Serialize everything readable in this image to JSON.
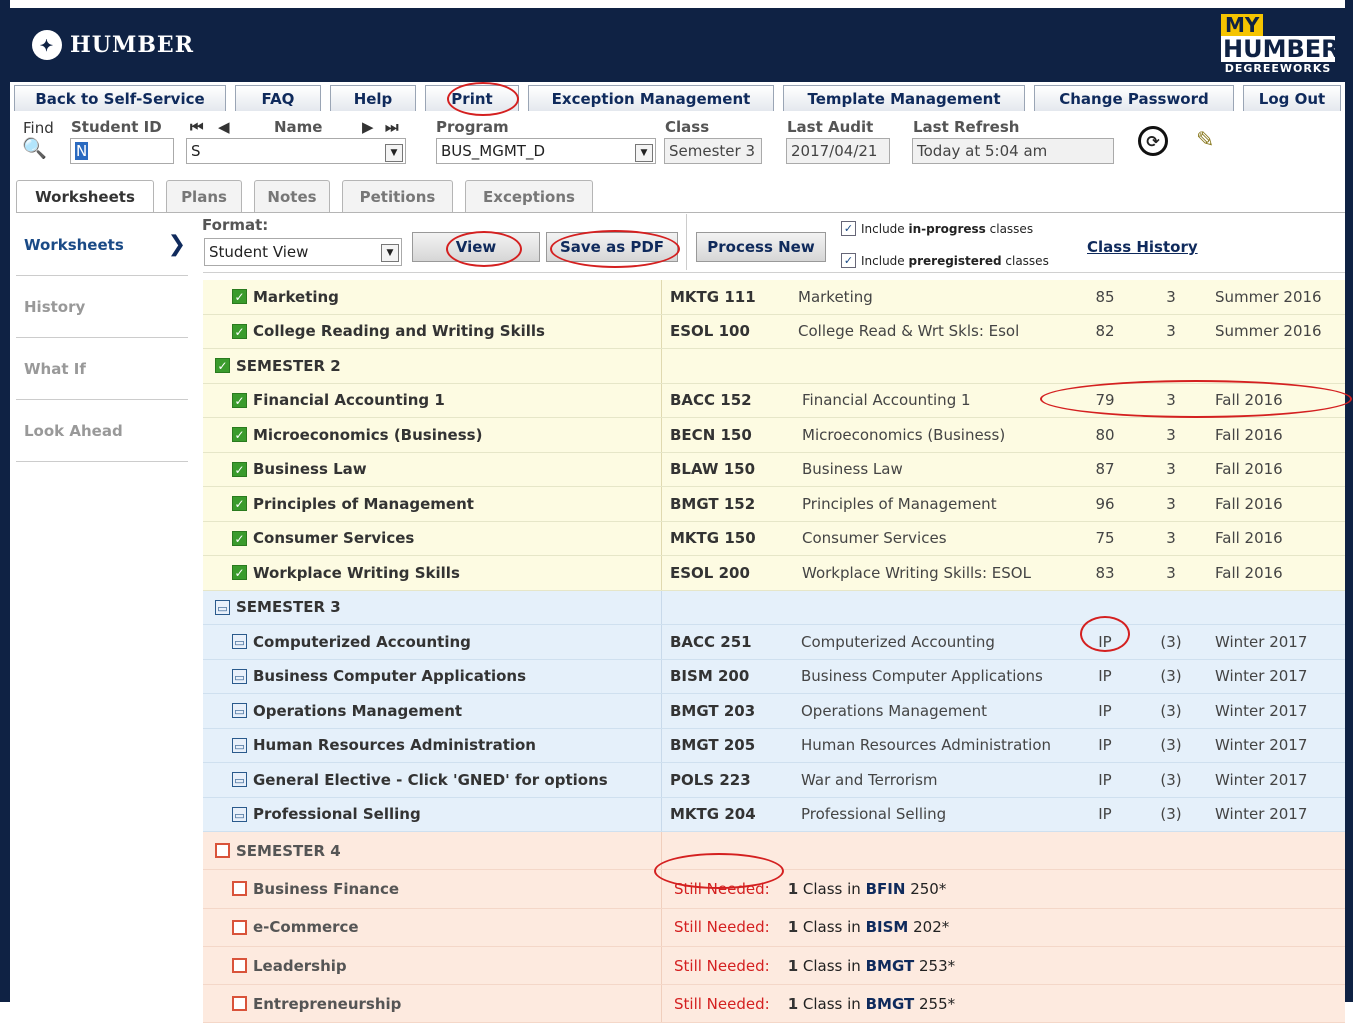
{
  "brand": {
    "logo_text": "HUMBER",
    "badge_my": "MY",
    "badge_humber": "HUMBER",
    "badge_dw": "DEGREEWORKS"
  },
  "nav": [
    "Back to Self-Service",
    "FAQ",
    "Help",
    "Print",
    "Exception Management",
    "Template Management",
    "Change Password",
    "Log Out"
  ],
  "search": {
    "find_label": "Find",
    "student_id_label": "Student ID",
    "name_label": "Name",
    "program_label": "Program",
    "class_label": "Class",
    "last_audit_label": "Last Audit",
    "last_refresh_label": "Last Refresh",
    "nav_first": "⏮",
    "nav_prev": "◀",
    "nav_next": "▶",
    "nav_last": "⏭",
    "student_id_value": "N",
    "name_value": "S",
    "program_value": "BUS_MGMT_D",
    "class_value": "Semester 3",
    "last_audit_value": "2017/04/21",
    "last_refresh_value": "Today at 5:04 am"
  },
  "tabs": [
    "Worksheets",
    "Plans",
    "Notes",
    "Petitions",
    "Exceptions"
  ],
  "sidebar": [
    "Worksheets",
    "History",
    "What If",
    "Look Ahead"
  ],
  "toolbar": {
    "format_label": "Format:",
    "format_value": "Student View",
    "view": "View",
    "save_pdf": "Save as PDF",
    "process_new": "Process New",
    "chk1_a": "Include ",
    "chk1_b": "in-progress",
    "chk1_c": " classes",
    "chk2_a": "Include ",
    "chk2_b": "preregistered",
    "chk2_c": " classes",
    "class_history": "Class History"
  },
  "rows": [
    {
      "kind": "course",
      "color": "yellow",
      "status": "ok",
      "name": "Marketing",
      "code": "MKTG 111",
      "title": "Marketing",
      "grade": "85",
      "credits": "3",
      "term": "Summer 2016"
    },
    {
      "kind": "course",
      "color": "yellow",
      "status": "ok",
      "name": "College Reading and Writing Skills",
      "code": "ESOL 100",
      "title": "College Read & Wrt Skls: Esol",
      "grade": "82",
      "credits": "3",
      "term": "Summer 2016"
    },
    {
      "kind": "header",
      "color": "yellow",
      "status": "ok",
      "name": "SEMESTER 2"
    },
    {
      "kind": "course",
      "color": "yellow",
      "status": "ok",
      "name": "Financial Accounting 1",
      "code": "BACC 152",
      "title": "Financial Accounting 1",
      "grade": "79",
      "credits": "3",
      "term": "Fall 2016"
    },
    {
      "kind": "course",
      "color": "yellow",
      "status": "ok",
      "name": "Microeconomics (Business)",
      "code": "BECN 150",
      "title": "Microeconomics (Business)",
      "grade": "80",
      "credits": "3",
      "term": "Fall 2016"
    },
    {
      "kind": "course",
      "color": "yellow",
      "status": "ok",
      "name": "Business Law",
      "code": "BLAW 150",
      "title": "Business Law",
      "grade": "87",
      "credits": "3",
      "term": "Fall 2016"
    },
    {
      "kind": "course",
      "color": "yellow",
      "status": "ok",
      "name": "Principles of Management",
      "code": "BMGT 152",
      "title": "Principles of Management",
      "grade": "96",
      "credits": "3",
      "term": "Fall 2016"
    },
    {
      "kind": "course",
      "color": "yellow",
      "status": "ok",
      "name": "Consumer Services",
      "code": "MKTG 150",
      "title": "Consumer Services",
      "grade": "75",
      "credits": "3",
      "term": "Fall 2016"
    },
    {
      "kind": "course",
      "color": "yellow",
      "status": "ok",
      "name": "Workplace Writing Skills",
      "code": "ESOL 200",
      "title": "Workplace Writing Skills: ESOL",
      "grade": "83",
      "credits": "3",
      "term": "Fall 2016"
    },
    {
      "kind": "header",
      "color": "blue",
      "status": "ip",
      "name": "SEMESTER 3"
    },
    {
      "kind": "course",
      "color": "blue",
      "status": "ip",
      "name": "Computerized Accounting",
      "code": "BACC 251",
      "title": "Computerized Accounting",
      "grade": "IP",
      "credits": "(3)",
      "term": "Winter 2017"
    },
    {
      "kind": "course",
      "color": "blue",
      "status": "ip",
      "name": "Business Computer Applications",
      "code": "BISM 200",
      "title": "Business Computer Applications",
      "grade": "IP",
      "credits": "(3)",
      "term": "Winter 2017"
    },
    {
      "kind": "course",
      "color": "blue",
      "status": "ip",
      "name": "Operations Management",
      "code": "BMGT 203",
      "title": "Operations Management",
      "grade": "IP",
      "credits": "(3)",
      "term": "Winter 2017"
    },
    {
      "kind": "course",
      "color": "blue",
      "status": "ip",
      "name": "Human Resources Administration",
      "code": "BMGT 205",
      "title": "Human Resources Administration",
      "grade": "IP",
      "credits": "(3)",
      "term": "Winter 2017"
    },
    {
      "kind": "course",
      "color": "blue",
      "status": "ip",
      "name": "General Elective - Click 'GNED' for options",
      "code": "POLS 223",
      "title": "War and Terrorism",
      "grade": "IP",
      "credits": "(3)",
      "term": "Winter 2017"
    },
    {
      "kind": "course",
      "color": "blue",
      "status": "ip",
      "name": "Professional Selling",
      "code": "MKTG 204",
      "title": "Professional Selling",
      "grade": "IP",
      "credits": "(3)",
      "term": "Winter 2017"
    },
    {
      "kind": "header",
      "color": "pink",
      "status": "no",
      "name": "SEMESTER 4"
    },
    {
      "kind": "needed",
      "color": "pink",
      "status": "no",
      "name": "Business Finance",
      "sn": "Still Needed:",
      "count": "1",
      "mid": "Class in",
      "subj": "BFIN",
      "num": "250*"
    },
    {
      "kind": "needed",
      "color": "pink",
      "status": "no",
      "name": "e-Commerce",
      "sn": "Still Needed:",
      "count": "1",
      "mid": "Class in",
      "subj": "BISM",
      "num": "202*"
    },
    {
      "kind": "needed",
      "color": "pink",
      "status": "no",
      "name": "Leadership",
      "sn": "Still Needed:",
      "count": "1",
      "mid": "Class in",
      "subj": "BMGT",
      "num": "253*"
    },
    {
      "kind": "needed",
      "color": "pink",
      "status": "no",
      "name": "Entrepreneurship",
      "sn": "Still Needed:",
      "count": "1",
      "mid": "Class in",
      "subj": "BMGT",
      "num": "255*"
    }
  ],
  "colors": {
    "navy": "#0f2244",
    "yellow_row": "#fdfbe2",
    "blue_row": "#e5f0fa",
    "pink_row": "#fdeadf",
    "annotation_red": "#d42020"
  }
}
